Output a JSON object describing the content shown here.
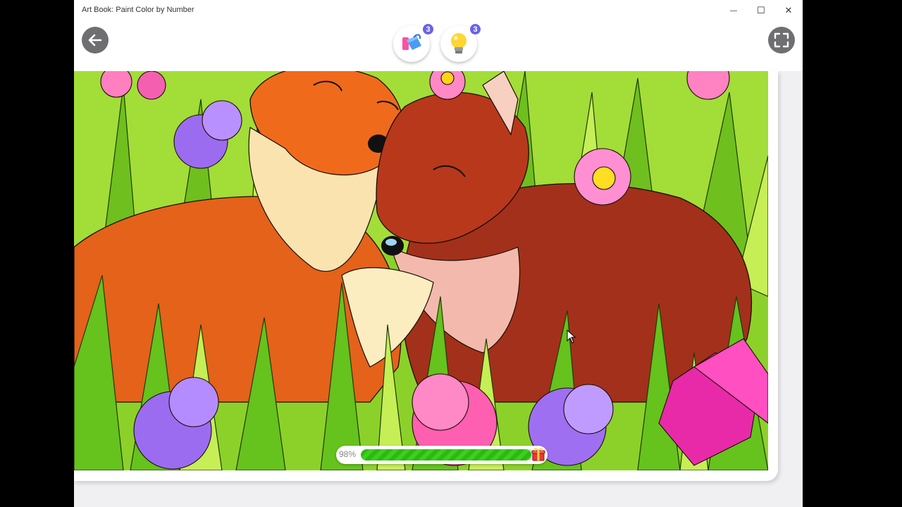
{
  "window": {
    "title": "Art Book: Paint Color by Number",
    "minimize_glyph": "—",
    "maximize_glyph": "☐",
    "close_glyph": "✕"
  },
  "toolbar": {
    "back_icon": "arrow-left-icon",
    "fullscreen_icon": "expand-icon",
    "boosters": [
      {
        "icon": "paint-bucket-icon",
        "count": "3"
      },
      {
        "icon": "lightbulb-hint-icon",
        "count": "3"
      }
    ]
  },
  "progress": {
    "label": "98%",
    "value": 0.98
  },
  "colors": {
    "accent": "#6b62e8",
    "progress_green": "#3ccf1f",
    "icon_gray": "#6f6f72"
  }
}
